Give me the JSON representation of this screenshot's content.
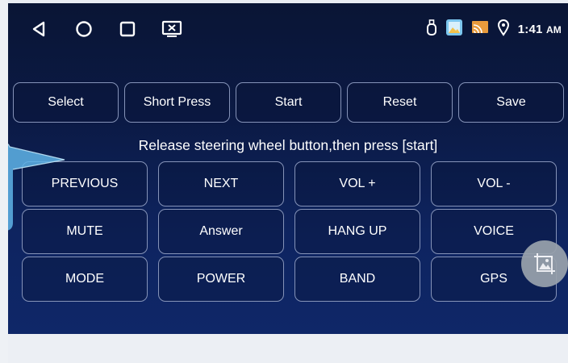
{
  "actions": [
    {
      "label": "Select"
    },
    {
      "label": "Short Press"
    },
    {
      "label": "Start"
    },
    {
      "label": "Reset"
    },
    {
      "label": "Save"
    }
  ],
  "instruction": "Release steering wheel button,then press [start]",
  "keys": [
    [
      "PREVIOUS",
      "NEXT",
      "VOL +",
      "VOL -"
    ],
    [
      "MUTE",
      "Answer",
      "HANG UP",
      "VOICE"
    ],
    [
      "MODE",
      "POWER",
      "BAND",
      "GPS"
    ]
  ],
  "status": {
    "time": "1:41",
    "ampm": "AM"
  },
  "icons": {
    "nav": [
      "back-icon",
      "home-icon",
      "recents-icon",
      "screen-icon"
    ],
    "status": [
      "usb-icon",
      "gallery-icon",
      "cast-icon",
      "location-icon"
    ]
  },
  "colors": {
    "background_top": "#0a1535",
    "background_bottom": "#0f2768",
    "button_border": "#8593b8",
    "bubble": "#5fb4e8"
  }
}
